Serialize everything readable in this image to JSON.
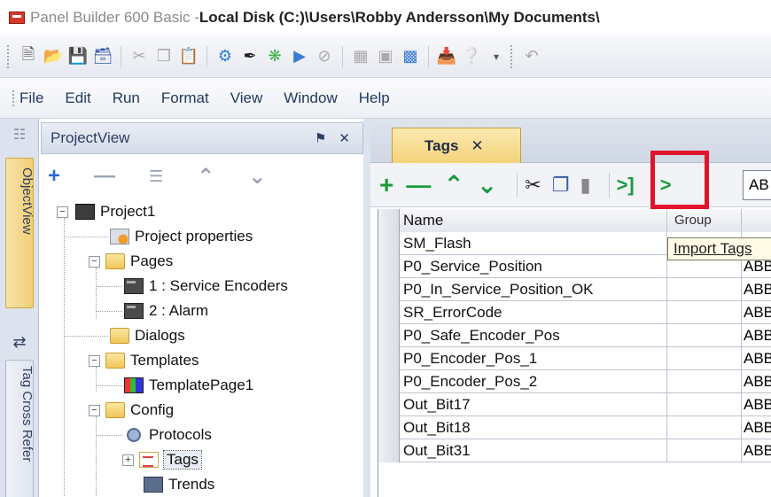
{
  "window": {
    "app_name": "Panel Builder 600 Basic - ",
    "path": "Local Disk (C:)\\Users\\Robby Andersson\\My Documents\\"
  },
  "toolbar": {
    "icons": [
      "new-icon",
      "open-icon",
      "save-icon",
      "save-all-icon",
      "cut-icon",
      "copy-icon",
      "paste-icon",
      "run-icon",
      "pen-icon",
      "gear-icon",
      "play-icon",
      "stop-icon",
      "grid-icon",
      "snap-icon",
      "layout-icon",
      "download-icon",
      "help-icon"
    ]
  },
  "menu": {
    "items": [
      "File",
      "Edit",
      "Run",
      "Format",
      "View",
      "Window",
      "Help"
    ]
  },
  "left_strip": {
    "tabs": [
      "ObjectView",
      "Tag Cross Refer"
    ]
  },
  "project_view": {
    "title": "ProjectView",
    "pin": "⚑",
    "close": "✕",
    "tree": [
      {
        "label": "Project1",
        "icon": "project-icon",
        "level": 0,
        "expander": "−"
      },
      {
        "label": "Project properties",
        "icon": "properties-icon",
        "level": 1,
        "expander": ""
      },
      {
        "label": "Pages",
        "icon": "folder-icon",
        "level": 1,
        "expander": "−"
      },
      {
        "label": "1 : Service Encoders",
        "icon": "page-icon",
        "level": 2,
        "expander": ""
      },
      {
        "label": "2 : Alarm",
        "icon": "page-icon",
        "level": 2,
        "expander": ""
      },
      {
        "label": "Dialogs",
        "icon": "folder-icon",
        "level": 1,
        "expander": ""
      },
      {
        "label": "Templates",
        "icon": "folder-icon",
        "level": 1,
        "expander": "−"
      },
      {
        "label": "TemplatePage1",
        "icon": "template-icon",
        "level": 2,
        "expander": ""
      },
      {
        "label": "Config",
        "icon": "folder-icon",
        "level": 1,
        "expander": "−"
      },
      {
        "label": "Protocols",
        "icon": "protocols-icon",
        "level": 2,
        "expander": ""
      },
      {
        "label": "Tags",
        "icon": "tags-icon",
        "level": 2,
        "expander": "+",
        "selected": true
      },
      {
        "label": "Trends",
        "icon": "trends-icon",
        "level": 2,
        "expander": ""
      }
    ]
  },
  "tab": {
    "label": "Tags",
    "close": "✕"
  },
  "tags_toolbar": {
    "input_value": "AB"
  },
  "grid": {
    "headers": [
      "Name",
      "Group",
      ""
    ],
    "rows": [
      {
        "name": "SM_Flash",
        "third": ""
      },
      {
        "name": "P0_Service_Position",
        "third": "ABB"
      },
      {
        "name": "P0_In_Service_Position_OK",
        "third": "ABB"
      },
      {
        "name": "SR_ErrorCode",
        "third": "ABB"
      },
      {
        "name": "P0_Safe_Encoder_Pos",
        "third": "ABB"
      },
      {
        "name": "P0_Encoder_Pos_1",
        "third": "ABB"
      },
      {
        "name": "P0_Encoder_Pos_2",
        "third": "ABB"
      },
      {
        "name": "Out_Bit17",
        "third": "ABB"
      },
      {
        "name": "Out_Bit18",
        "third": "ABB"
      },
      {
        "name": "Out_Bit31",
        "third": "ABB"
      }
    ]
  },
  "tooltip": {
    "text": "Import Tags"
  },
  "colors": {
    "highlight": "#e0142a",
    "tab_yellow": "#f4d27a",
    "plus_green": "#1a9a3a",
    "minus_gray": "#8a8a8a"
  }
}
